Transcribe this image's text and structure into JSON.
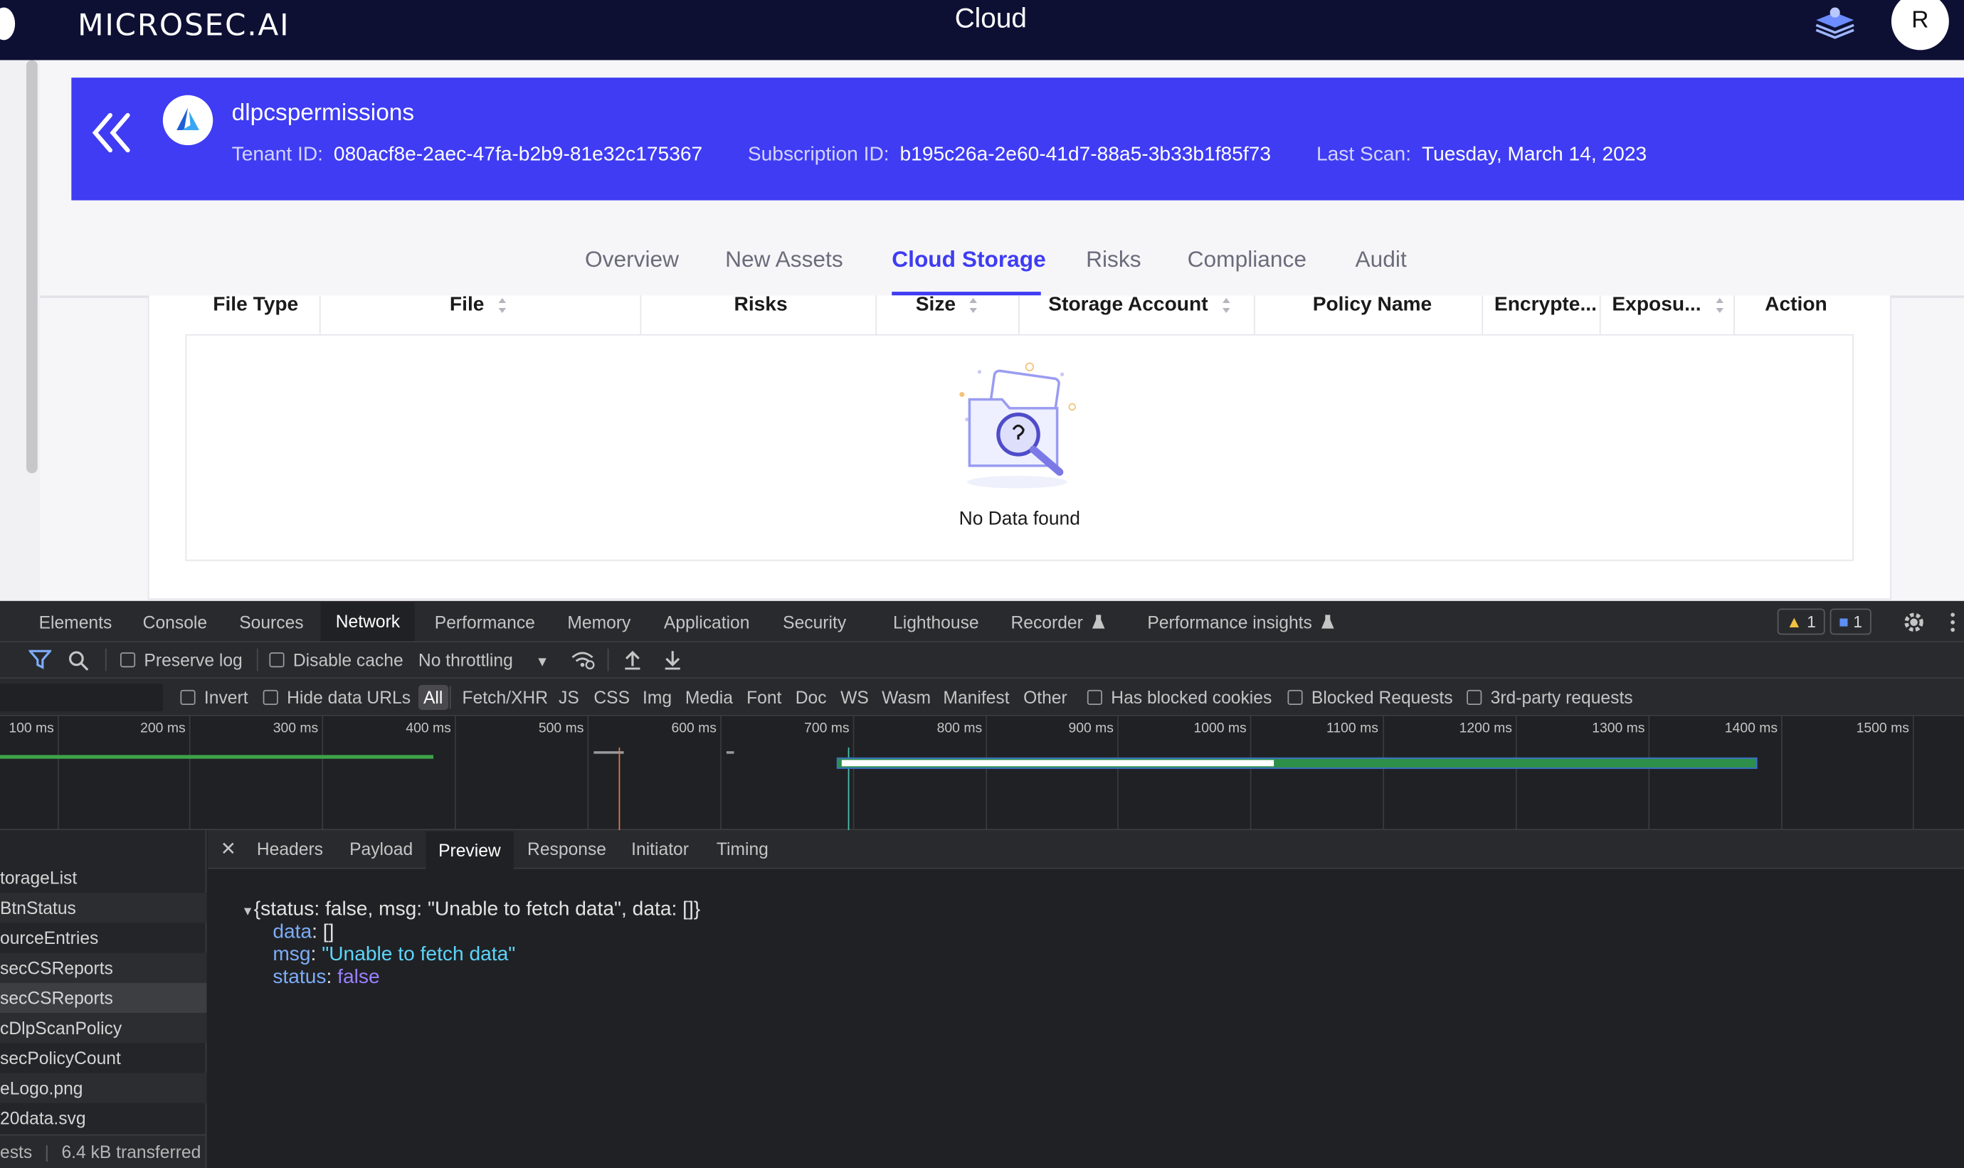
{
  "header": {
    "brand": "MICROSEC.AI",
    "title": "Cloud",
    "avatar_initial": "R",
    "icons": [
      "moon-icon",
      "layers-icon"
    ]
  },
  "banner": {
    "account_name": "dlpcspermissions",
    "tenant_label": "Tenant ID:",
    "tenant_value": "080acf8e-2aec-47fa-b2b9-81e32c175367",
    "subscription_label": "Subscription ID:",
    "subscription_value": "b195c26a-2e60-41d7-88a5-3b33b1f85f73",
    "last_scan_label": "Last Scan:",
    "last_scan_value": "Tuesday, March 14, 2023",
    "accent": "#3f3cf3"
  },
  "tabs": [
    {
      "label": "Overview"
    },
    {
      "label": "New Assets"
    },
    {
      "label": "Cloud Storage",
      "active": true
    },
    {
      "label": "Risks"
    },
    {
      "label": "Compliance"
    },
    {
      "label": "Audit"
    }
  ],
  "table": {
    "columns": [
      "File Type",
      "File",
      "Risks",
      "Size",
      "Storage Account",
      "Policy Name",
      "Encrypte...",
      "Exposu...",
      "Action"
    ],
    "empty_text": "No Data found"
  },
  "devtools": {
    "panel_tabs": [
      "Elements",
      "Console",
      "Sources",
      "Network",
      "Performance",
      "Memory",
      "Application",
      "Security",
      "Lighthouse",
      "Recorder",
      "Performance insights"
    ],
    "active_panel": "Network",
    "warnings_count": "1",
    "messages_count": "1",
    "toolbar": {
      "preserve_log": "Preserve log",
      "disable_cache": "Disable cache",
      "throttling": "No throttling"
    },
    "filters": {
      "invert": "Invert",
      "hide_data_urls": "Hide data URLs",
      "types": [
        "All",
        "Fetch/XHR",
        "JS",
        "CSS",
        "Img",
        "Media",
        "Font",
        "Doc",
        "WS",
        "Wasm",
        "Manifest",
        "Other"
      ],
      "has_blocked_cookies": "Has blocked cookies",
      "blocked_requests": "Blocked Requests",
      "third_party": "3rd-party requests"
    },
    "timeline_ticks": [
      "100 ms",
      "200 ms",
      "300 ms",
      "400 ms",
      "500 ms",
      "600 ms",
      "700 ms",
      "800 ms",
      "900 ms",
      "1000 ms",
      "1100 ms",
      "1200 ms",
      "1300 ms",
      "1400 ms",
      "1500 ms"
    ],
    "requests": [
      "torageList",
      "BtnStatus",
      "ourceEntries",
      "secCSReports",
      "secCSReports",
      "cDlpScanPolicy",
      "secPolicyCount",
      "eLogo.png",
      "20data.svg"
    ],
    "selected_request_index": 4,
    "footer_requests": "ests",
    "footer_transferred": "6.4 kB transferred",
    "detail_tabs": [
      "Headers",
      "Payload",
      "Preview",
      "Response",
      "Initiator",
      "Timing"
    ],
    "active_detail_tab": "Preview",
    "preview": {
      "summary": "{status: false, msg: \"Unable to fetch data\", data: []}",
      "data_key": "data",
      "data_value": "[]",
      "msg_key": "msg",
      "msg_value": "\"Unable to fetch data\"",
      "status_key": "status",
      "status_value": "false"
    }
  }
}
